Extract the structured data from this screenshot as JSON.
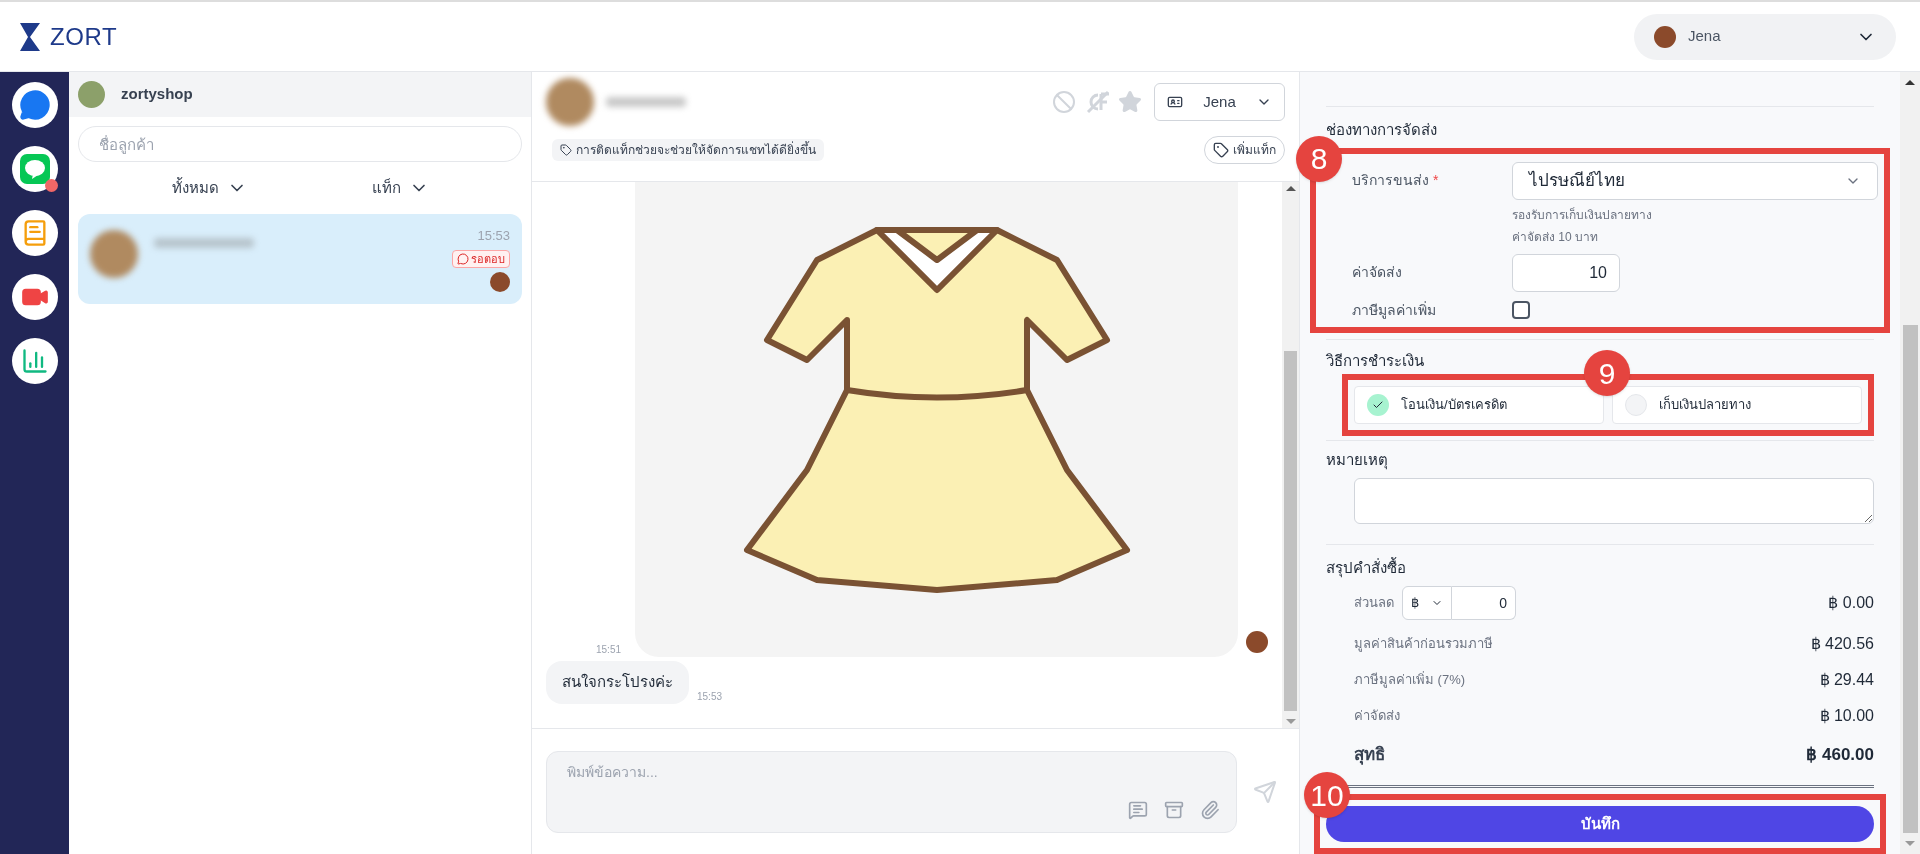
{
  "header": {
    "logo": "ZORT",
    "user": {
      "name": "Jena"
    }
  },
  "nav": [
    {
      "kind": "messenger",
      "unread": false
    },
    {
      "kind": "line",
      "unread": true
    },
    {
      "kind": "orders",
      "unread": false
    },
    {
      "kind": "video",
      "unread": false
    },
    {
      "kind": "stats",
      "unread": false
    }
  ],
  "chat_list": {
    "shop": "zortyshop",
    "search_placeholder": "ชื่อลูกค้า",
    "filters": [
      {
        "label": "ทั้งหมด"
      },
      {
        "label": "แท็ก"
      }
    ],
    "conversations": [
      {
        "time": "15:53",
        "status": "รอตอบ",
        "selected": true
      }
    ]
  },
  "chat": {
    "assignee": "Jena",
    "tag_hint": "การติดแท็กช่วยจะช่วยให้จัดการแชทได้ดียิ่งขึ้น",
    "add_tag": "เพิ่มแท็ก",
    "messages": [
      {
        "kind": "image",
        "time": "15:51"
      },
      {
        "kind": "text",
        "text": "สนใจกระโปรงค่ะ",
        "time": "15:53"
      }
    ],
    "composer_placeholder": "พิมพ์ข้อความ..."
  },
  "order": {
    "shipping": {
      "title": "ช่องทางการจัดส่ง",
      "annotation": "8",
      "carrier_label": "บริการขนส่ง",
      "required_mark": "*",
      "carrier": "ไปรษณีย์ไทย",
      "notes": [
        "รองรับการเก็บเงินปลายทาง",
        "ค่าจัดส่ง 10 บาท"
      ],
      "fee_label": "ค่าจัดส่ง",
      "fee": "10",
      "vat_label": "ภาษีมูลค่าเพิ่ม",
      "vat_checked": false
    },
    "payment": {
      "title": "วิธีการชำระเงิน",
      "annotation": "9",
      "options": [
        {
          "label": "โอนเงิน/บัตรเครดิต",
          "selected": true
        },
        {
          "label": "เก็บเงินปลายทาง",
          "selected": false
        }
      ]
    },
    "remarks": {
      "title": "หมายเหตุ"
    },
    "summary": {
      "title": "สรุปคำสั่งซื้อ",
      "discount": {
        "label": "ส่วนลด",
        "unit": "฿",
        "value": "0",
        "amount": "฿ 0.00"
      },
      "rows": [
        {
          "label": "มูลค่าสินค้าก่อนรวมภาษี",
          "amount": "฿ 420.56"
        },
        {
          "label": "ภาษีมูลค่าเพิ่ม (7%)",
          "amount": "฿ 29.44"
        },
        {
          "label": "ค่าจัดส่ง",
          "amount": "฿ 10.00"
        }
      ],
      "total": {
        "label": "สุทธิ",
        "amount": "฿ 460.00"
      }
    },
    "save": {
      "label": "บันทึก",
      "annotation": "10"
    }
  }
}
